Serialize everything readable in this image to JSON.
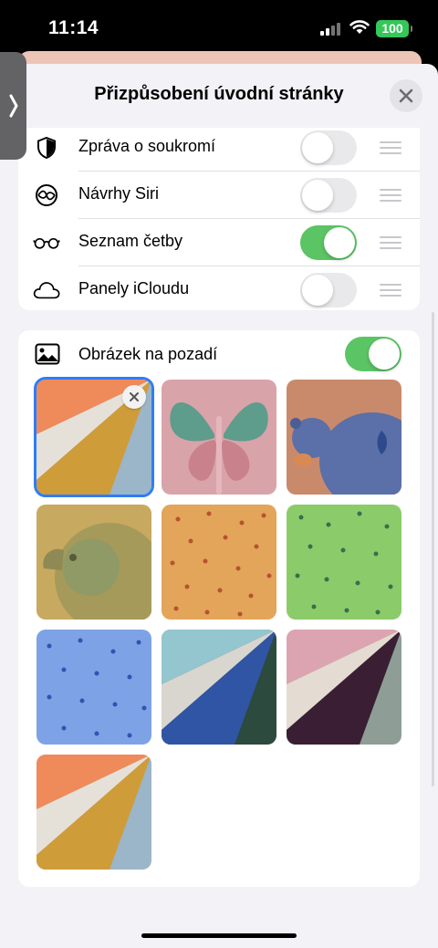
{
  "status_bar": {
    "time": "11:14",
    "battery": "100",
    "battery_color": "#34c759"
  },
  "sheet": {
    "title": "Přizpůsobení úvodní stránky",
    "close_icon": "close-icon",
    "side_tab_icon": "chevron-right-icon"
  },
  "sections": [
    {
      "label": "Zpráva o soukromí",
      "icon": "shield-icon",
      "enabled": false
    },
    {
      "label": "Návrhy Siri",
      "icon": "siri-icon",
      "enabled": false
    },
    {
      "label": "Seznam četby",
      "icon": "glasses-icon",
      "enabled": true
    },
    {
      "label": "Panely iCloudu",
      "icon": "cloud-icon",
      "enabled": false
    }
  ],
  "background": {
    "label": "Obrázek na pozadí",
    "icon": "photo-icon",
    "enabled": true,
    "selected_index": 0,
    "wallpapers": [
      "paper-fold-orange",
      "butterfly-pink",
      "bear-blue",
      "parrot-olive",
      "pattern-orange",
      "pattern-green",
      "pattern-blue",
      "paper-fold-teal",
      "paper-fold-plum",
      "paper-fold-orange"
    ]
  },
  "colors": {
    "toggle_on": "#5bc464",
    "selection": "#2f7cf6"
  }
}
